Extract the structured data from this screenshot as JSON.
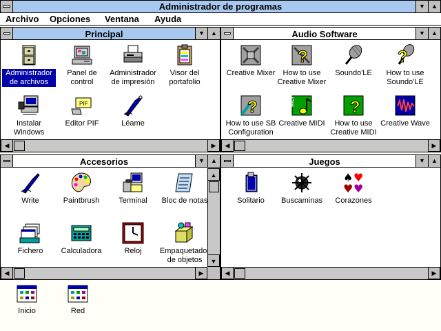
{
  "app": {
    "title": "Administrador de programas"
  },
  "menu": [
    "Archivo",
    "Opciones",
    "Ventana",
    "Ayuda"
  ],
  "colors": {
    "active_caption": "#a8c8f0",
    "selection": "#0000a8",
    "workspace": "#fffff8"
  },
  "groups": {
    "principal": {
      "title": "Principal",
      "items": [
        {
          "label": "Administrador de archivos",
          "icon": "file-cabinet-icon"
        },
        {
          "label": "Panel de control",
          "icon": "control-panel-icon"
        },
        {
          "label": "Administrador de impresión",
          "icon": "printer-icon"
        },
        {
          "label": "Visor del portafolio",
          "icon": "clipboard-viewer-icon"
        },
        {
          "label": "Instalar Windows",
          "icon": "setup-computer-icon"
        },
        {
          "label": "Editor PIF",
          "icon": "pif-editor-icon"
        },
        {
          "label": "Léame",
          "icon": "readme-pen-icon"
        }
      ]
    },
    "audio": {
      "title": "Audio Software",
      "items": [
        {
          "label": "Creative Mixer",
          "icon": "mixer-icon"
        },
        {
          "label": "How to use Creative Mixer",
          "icon": "help-mixer-icon"
        },
        {
          "label": "Soundo'LE",
          "icon": "microphone-icon"
        },
        {
          "label": "How to use Soundo'LE",
          "icon": "help-microphone-icon"
        },
        {
          "label": "How to use SB Configuration",
          "icon": "help-config-icon"
        },
        {
          "label": "Creative MIDI",
          "icon": "midi-icon"
        },
        {
          "label": "How to use Creative MIDI",
          "icon": "help-midi-icon"
        },
        {
          "label": "Creative Wave",
          "icon": "wave-icon"
        }
      ]
    },
    "accesorios": {
      "title": "Accesorios",
      "items": [
        {
          "label": "Write",
          "icon": "write-pen-icon"
        },
        {
          "label": "Paintbrush",
          "icon": "palette-icon"
        },
        {
          "label": "Terminal",
          "icon": "terminal-icon"
        },
        {
          "label": "Bloc de notas",
          "icon": "notepad-icon"
        },
        {
          "label": "Fichero",
          "icon": "cardfile-icon"
        },
        {
          "label": "Calculadora",
          "icon": "calculator-icon"
        },
        {
          "label": "Reloj",
          "icon": "clock-icon"
        },
        {
          "label": "Empaquetador de objetos",
          "icon": "object-packager-icon"
        }
      ]
    },
    "juegos": {
      "title": "Juegos",
      "items": [
        {
          "label": "Solitario",
          "icon": "solitaire-card-icon"
        },
        {
          "label": "Buscaminas",
          "icon": "mine-icon"
        },
        {
          "label": "Corazones",
          "icon": "card-suits-icon"
        }
      ]
    }
  },
  "minimized": [
    {
      "label": "Inicio",
      "icon": "program-group-icon"
    },
    {
      "label": "Red",
      "icon": "program-group-icon"
    }
  ]
}
